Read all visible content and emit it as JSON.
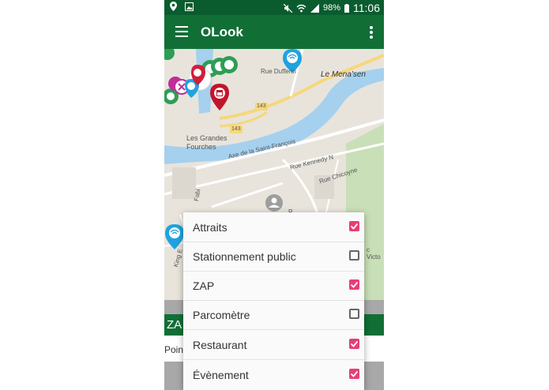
{
  "status_bar": {
    "battery": "98%",
    "time": "11:06"
  },
  "app": {
    "title": "OLook"
  },
  "map": {
    "labels": {
      "rue_dufferin": "Rue Dufferin",
      "le_menasen": "Le Mena'sen",
      "road_143_a": "143",
      "road_143_b": "143",
      "grandes_fourches": "Les Grandes Fourches",
      "saint_francois": "Axe de la Saint-François",
      "kennedy": "Rue Kennedy N",
      "chicoyne": "Rue Chicoyne",
      "fabi": "Fabi",
      "king": "King E",
      "victo": "c Victo",
      "r_small": "R"
    }
  },
  "below": {
    "header_text": "ZA",
    "sub_text": "Poin"
  },
  "filters": [
    {
      "label": "Attraits",
      "checked": true
    },
    {
      "label": "Stationnement public",
      "checked": false
    },
    {
      "label": "ZAP",
      "checked": true
    },
    {
      "label": "Parcomètre",
      "checked": false
    },
    {
      "label": "Restaurant",
      "checked": true
    },
    {
      "label": "Évènement",
      "checked": true
    }
  ],
  "colors": {
    "appbar": "#116f36",
    "statusbar": "#0a5c2e",
    "checkbox_on": "#e83e74",
    "river": "#a5d0ee",
    "park": "#c8dfb8"
  }
}
